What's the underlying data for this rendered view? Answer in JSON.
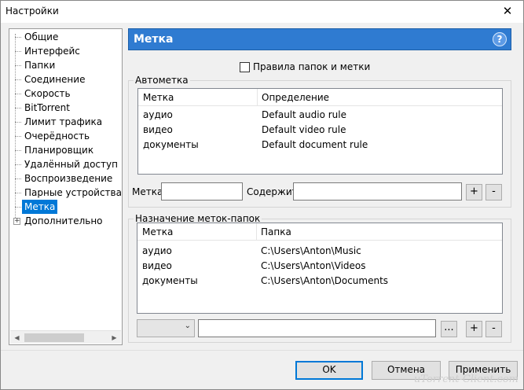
{
  "window": {
    "title": "Настройки",
    "close_glyph": "✕"
  },
  "sidebar": {
    "items": [
      {
        "label": "Общие"
      },
      {
        "label": "Интерфейс"
      },
      {
        "label": "Папки"
      },
      {
        "label": "Соединение"
      },
      {
        "label": "Скорость"
      },
      {
        "label": "BitTorrent"
      },
      {
        "label": "Лимит трафика"
      },
      {
        "label": "Очерёдность"
      },
      {
        "label": "Планировщик"
      },
      {
        "label": "Удалённый доступ"
      },
      {
        "label": "Воспроизведение"
      },
      {
        "label": "Парные устройства"
      },
      {
        "label": "Метка",
        "selected": true
      },
      {
        "label": "Дополнительно",
        "expandable": true
      }
    ],
    "expander_glyph": "+",
    "scroll_left": "◀",
    "scroll_right": "▶"
  },
  "panel": {
    "title": "Метка",
    "help_glyph": "?",
    "checkbox_label": "Правила папок и метки",
    "checkbox_checked": false
  },
  "autolabel": {
    "group_title": "Автометка",
    "columns": [
      "Метка",
      "Определение"
    ],
    "rows": [
      [
        "аудио",
        "Default audio rule"
      ],
      [
        "видео",
        "Default video rule"
      ],
      [
        "документы",
        "Default document rule"
      ]
    ],
    "label_field": {
      "label": "Метка",
      "value": ""
    },
    "contains_field": {
      "label": "Содержит",
      "value": ""
    },
    "add_glyph": "+",
    "remove_glyph": "-"
  },
  "folders": {
    "group_title": "Назначение меток-папок",
    "columns": [
      "Метка",
      "Папка"
    ],
    "rows": [
      [
        "аудио",
        "C:\\Users\\Anton\\Music"
      ],
      [
        "видео",
        "C:\\Users\\Anton\\Videos"
      ],
      [
        "документы",
        "C:\\Users\\Anton\\Documents"
      ]
    ],
    "combo_value": "",
    "combo_glyph": "⌄",
    "path_value": "",
    "browse_glyph": "...",
    "add_glyph": "+",
    "remove_glyph": "-"
  },
  "footer": {
    "ok_label": "OK",
    "cancel_label": "Отмена",
    "apply_label": "Применить"
  },
  "watermark": "uTorrent-Client.com"
}
